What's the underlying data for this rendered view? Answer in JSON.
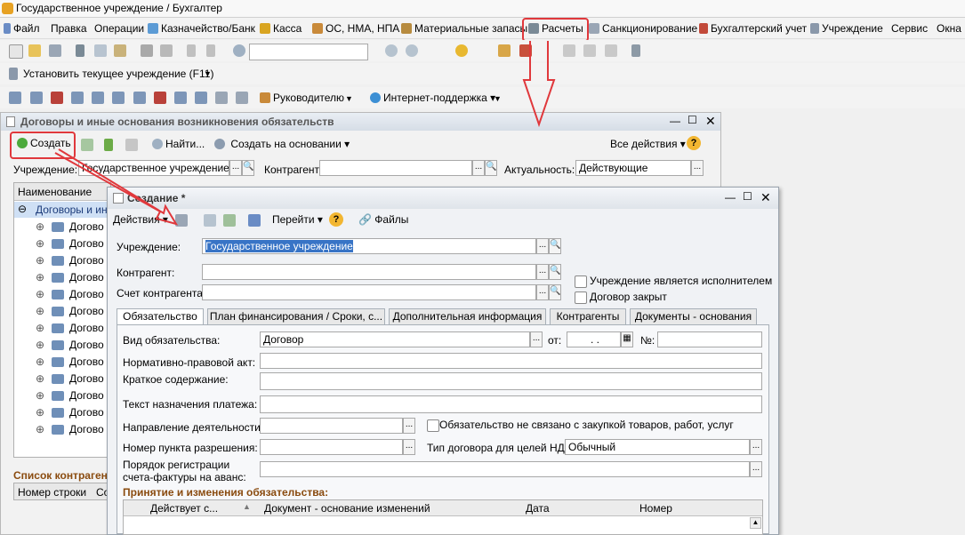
{
  "app": {
    "title": "Государственное учреждение / Бухгалтер"
  },
  "menu": [
    "Файл",
    "Правка",
    "Операции",
    "Казначейство/Банк",
    "Касса",
    "ОС, НМА, НПА",
    "Материальные запасы",
    "Расчеты",
    "Санкционирование",
    "Бухгалтерский учет",
    "Учреждение",
    "Сервис",
    "Окна"
  ],
  "toolbar3": {
    "set_institution": "Установить текущее учреждение (F11)"
  },
  "toolbar4": {
    "head": "Руководителю",
    "support": "Интернет-поддержка"
  },
  "list_window": {
    "title": "Договоры и иные основания возникновения обязательств",
    "create": "Создать",
    "find": "Найти...",
    "create_based": "Создать на основании",
    "all_actions": "Все действия",
    "institution_label": "Учреждение:",
    "institution_value": "Государственное учреждение",
    "counterparty_label": "Контрагент:",
    "counterparty_value": "",
    "relevance_label": "Актуальность:",
    "relevance_value": "Действующие",
    "col_name": "Наименование",
    "tree_root": "Договоры и ин",
    "tree_item": "Догово",
    "tree_count": 13,
    "counterparty_list": "Список контрагентов",
    "col_row_num": "Номер строки",
    "col_co": "Со"
  },
  "form": {
    "title": "Создание *",
    "actions": "Действия",
    "goto": "Перейти",
    "files": "Файлы",
    "institution_label": "Учреждение:",
    "institution_value": "Государственное учреждение",
    "counterparty_label": "Контрагент:",
    "account_label": "Счет контрагента:",
    "chk_executor": "Учреждение является исполнителем",
    "chk_closed": "Договор закрыт",
    "tabs": [
      "Обязательство",
      "План финансирования / Сроки, с...",
      "Дополнительная информация",
      "Контрагенты",
      "Документы - основания"
    ],
    "kind_label": "Вид обязательства:",
    "kind_value": "Договор",
    "from_label": "от:",
    "date_value": ". .",
    "num_label": "№:",
    "legal_act_label": "Нормативно-правовой акт:",
    "summary_label": "Краткое содержание:",
    "payment_text_label": "Текст назначения платежа:",
    "direction_label": "Направление деятельности:",
    "chk_no_purchase": "Обязательство не связано с закупкой товаров, работ, услуг",
    "permit_label": "Номер пункта разрешения:",
    "vat_type_label": "Тип договора для целей НДС:",
    "vat_type_value": "Обычный",
    "invoice_order_label_1": "Порядок регистрации",
    "invoice_order_label_2": "счета-фактуры на аванс:",
    "changes_section": "Принятие и изменения обязательства:",
    "grid_cols": [
      "Действует с...",
      "Документ - основание изменений",
      "Дата",
      "Номер"
    ]
  },
  "colors": {
    "accent_red": "#e0383c",
    "section_brown": "#8a4b0f",
    "selection": "#3874c6"
  }
}
